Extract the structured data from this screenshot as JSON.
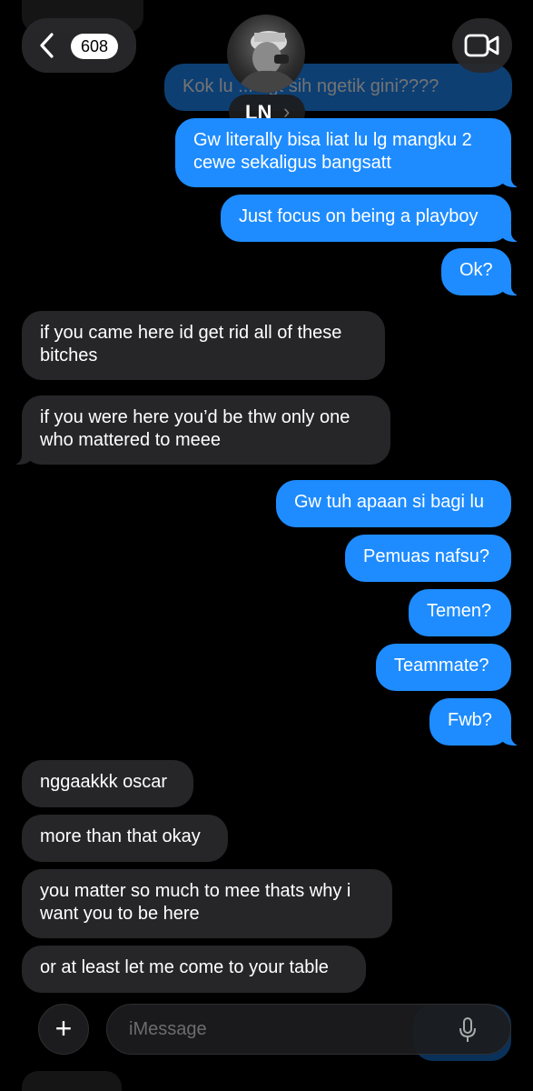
{
  "header": {
    "back_count": "608",
    "contact_initials": "LN",
    "contact_chevron": "›"
  },
  "top_partial": "Kok lu ... bgt sih ngetik gini????",
  "messages": {
    "m1": "Gw literally bisa liat lu lg mangku 2 cewe sekaligus bangsatt",
    "m2": "Just focus on being a playboy",
    "m3": "Ok?",
    "m4": "if you came here id get rid all of these bitches",
    "m5": "if you were here you’d be thw only one who mattered to meee",
    "m6": "Gw tuh apaan si bagi lu",
    "m7": "Pemuas nafsu?",
    "m8": "Temen?",
    "m9": "Teammate?",
    "m10": "Fwb?",
    "m11": "nggaakkk oscar",
    "m12": "more than that okay",
    "m13": "you matter so much to mee thats why i want you to be here",
    "m14": "or at least let me come to your table"
  },
  "composer": {
    "placeholder": "iMessage",
    "add_symbol": "+"
  },
  "colors": {
    "outgoing": "#1e8cff",
    "incoming": "#262628",
    "background": "#000000"
  },
  "icons": [
    "back-chevron-icon",
    "video-camera-icon",
    "plus-icon",
    "microphone-icon"
  ]
}
